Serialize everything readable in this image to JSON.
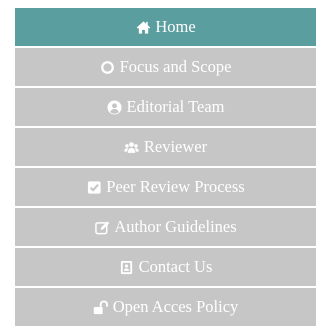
{
  "menu": {
    "items": [
      {
        "label": "Home",
        "icon": "home-icon",
        "active": true
      },
      {
        "label": "Focus and Scope",
        "icon": "circle-icon",
        "active": false
      },
      {
        "label": "Editorial Team",
        "icon": "user-circle-icon",
        "active": false
      },
      {
        "label": "Reviewer",
        "icon": "users-icon",
        "active": false
      },
      {
        "label": "Peer Review Process",
        "icon": "check-square-icon",
        "active": false
      },
      {
        "label": "Author Guidelines",
        "icon": "edit-icon",
        "active": false
      },
      {
        "label": "Contact Us",
        "icon": "address-card-icon",
        "active": false
      },
      {
        "label": "Open Acces Policy",
        "icon": "unlock-icon",
        "active": false
      }
    ]
  },
  "colors": {
    "active_bg": "#5a9e9f",
    "item_bg": "#c6c6c6",
    "text": "#ffffff"
  }
}
